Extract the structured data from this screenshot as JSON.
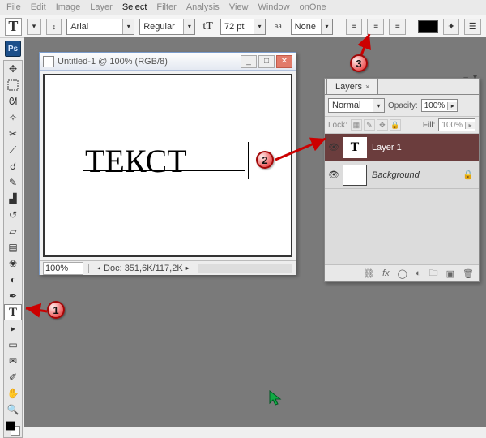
{
  "menu": {
    "items": [
      "File",
      "Edit",
      "Image",
      "Layer",
      "Select",
      "Filter",
      "Analysis",
      "View",
      "Window",
      "onOne"
    ],
    "activeIndex": 4
  },
  "options": {
    "tool_glyph": "T",
    "font": "Arial",
    "weight": "Regular",
    "size_glyph": "tT",
    "size": "72 pt",
    "aa_label": "aa",
    "aa_value": "None"
  },
  "doc": {
    "title": "Untitled-1 @ 100% (RGB/8)",
    "text": "ТЕКСТ",
    "zoom": "100%",
    "info": "Doc: 351,6K/117,2K"
  },
  "layers": {
    "panel_title": "Layers",
    "blend_mode": "Normal",
    "opacity_label": "Opacity:",
    "opacity_value": "100%",
    "lock_label": "Lock:",
    "fill_label": "Fill:",
    "fill_value": "100%",
    "rows": [
      {
        "thumb": "T",
        "name": "Layer 1",
        "selected": true,
        "locked": false,
        "italic": false
      },
      {
        "thumb": "",
        "name": "Background",
        "selected": false,
        "locked": true,
        "italic": true
      }
    ]
  },
  "annotations": {
    "b1": "1",
    "b2": "2",
    "b3": "3"
  }
}
